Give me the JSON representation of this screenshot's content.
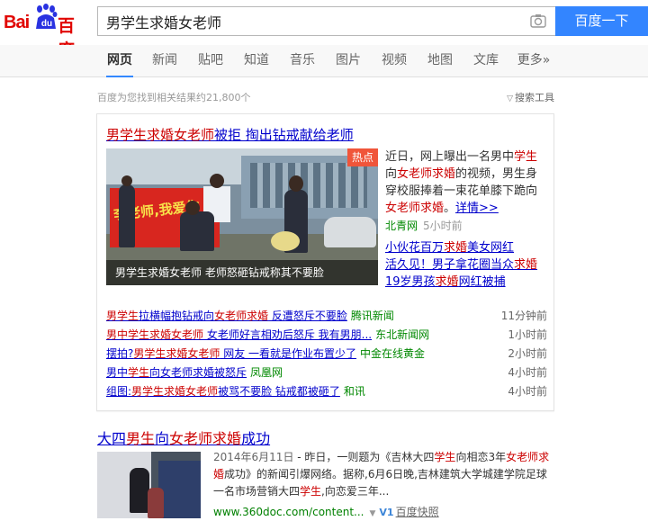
{
  "logo": {
    "bai": "Bai",
    "du": "du",
    "cn": "百度"
  },
  "search": {
    "query": "男学生求婚女老师",
    "button": "百度一下"
  },
  "tabs": [
    "网页",
    "新闻",
    "贴吧",
    "知道",
    "音乐",
    "图片",
    "视频",
    "地图",
    "文库",
    "更多»"
  ],
  "result_count": "百度为您找到相关结果约21,800个",
  "search_tools": "搜索工具",
  "news_card": {
    "title": {
      "hl1": "男学生求婚女老师",
      "rest": "被拒 掏出钻戒献给老师"
    },
    "hot_badge": "热点",
    "photo_banner_text": "李老师,我爱你",
    "photo_caption": "男学生求婚女老师 老师怒砸钻戒称其不要脸",
    "summary": {
      "p1": "近日，网上曝出一名男中",
      "hl1": "学生",
      "p2": "向",
      "hl2": "女老师求婚",
      "p3": "的视频，男生身穿校服捧着一束花单膝下跪向",
      "hl3": "女老师求婚",
      "p4": "。",
      "more": "详情>>"
    },
    "source": "北青网",
    "time": "5小时前",
    "sub_links": [
      {
        "a": "小伙花百万",
        "hl": "求婚",
        "b": "美女网红"
      },
      {
        "a": "活久见！男子拿花圈当众",
        "hl": "求婚",
        "b": ""
      },
      {
        "a": "19岁男孩",
        "hl": "求婚",
        "b": "网红被捕"
      }
    ],
    "list": [
      {
        "hl1": "男学生",
        "t1": "拉横幅抱钻戒向",
        "hl2": "女老师求婚",
        "t2": " 反遭怒斥不要脸",
        "src": "腾讯新闻",
        "time": "11分钟前"
      },
      {
        "hl1": "男中学生求婚女老师",
        "t1": " 女老师好言相劝后怒斥 我有男朋...",
        "hl2": "",
        "t2": "",
        "src": "东北新闻网",
        "time": "1小时前"
      },
      {
        "hl1": "",
        "t1": "摆拍?",
        "hl2": "男学生求婚女老师",
        "t2": " 网友 一看就是作业布置少了",
        "src": "中金在线黄金",
        "time": "2小时前"
      },
      {
        "hl1": "",
        "t1": "男中",
        "hl2": "学生",
        "t2": "向女老师求婚被怒斥",
        "src": "凤凰网",
        "time": "4小时前"
      },
      {
        "hl1": "",
        "t1": "组图:",
        "hl2": "男学生求婚女老师",
        "t2": "被骂不要脸 钻戒都被砸了",
        "src": "和讯",
        "time": "4小时前"
      }
    ]
  },
  "result2": {
    "title": {
      "t1": "大四",
      "hl1": "男生",
      "t2": "向",
      "hl2": "女老师求婚",
      "t3": "成功"
    },
    "date": "2014年6月11日",
    "abstract": {
      "p1": " - 昨日，一则题为《吉林大四",
      "hl1": "学生",
      "p2": "向相恋3年",
      "hl2": "女老师求婚",
      "p3": "成功》的新闻引爆网络。据称,6月6日晚,吉林建筑大学城建学院足球一名市场营销大四",
      "hl3": "学生",
      "p4": ",向恋爱三年..."
    },
    "url": "www.360doc.com/content...",
    "v1": "V1",
    "snapshot": "百度快照"
  },
  "colors": {
    "link": "#0000cc",
    "highlight": "#cc0000",
    "source": "#008000",
    "search_button": "#3385ff",
    "logo_red": "#e10602"
  }
}
